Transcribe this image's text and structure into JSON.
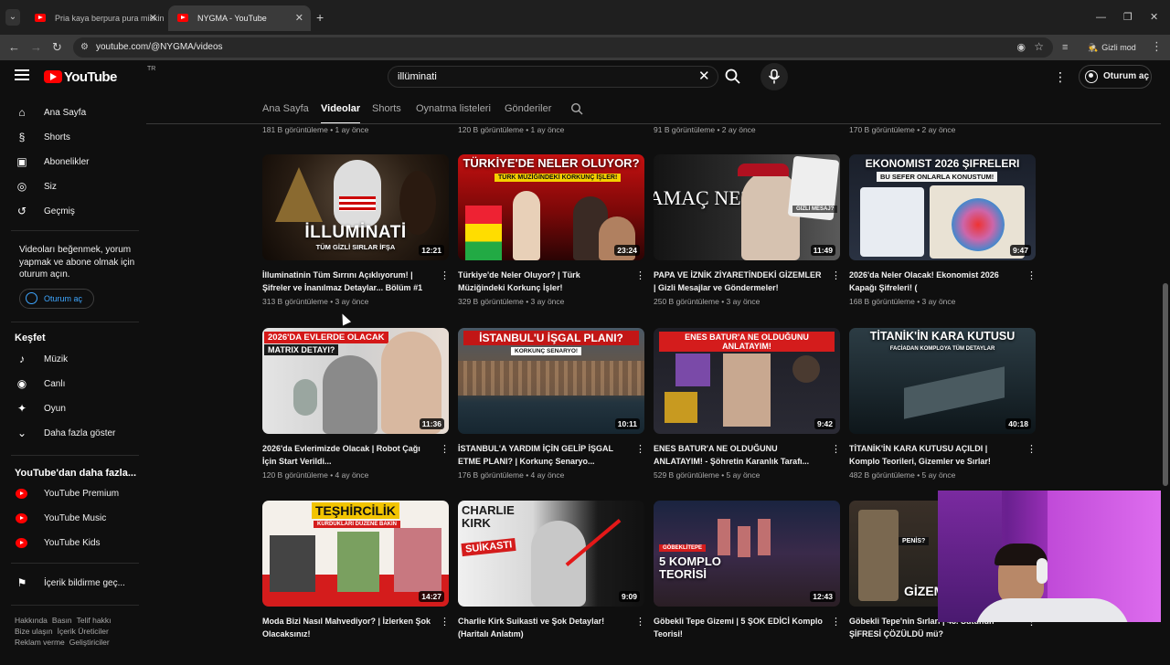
{
  "browser": {
    "tabs": [
      {
        "title": "Pria kaya berpura pura miskin u",
        "active": false
      },
      {
        "title": "NYGMA - YouTube",
        "active": true
      }
    ],
    "url": "youtube.com/@NYGMA/videos",
    "incognito_label": "Gizli mod"
  },
  "header": {
    "logo": "YouTube",
    "region": "TR",
    "search_query": "illüminati",
    "signin_label": "Oturum aç"
  },
  "sidebar": {
    "main": [
      {
        "label": "Ana Sayfa",
        "icon": "home-icon"
      },
      {
        "label": "Shorts",
        "icon": "shorts-icon"
      },
      {
        "label": "Abonelikler",
        "icon": "subscriptions-icon"
      },
      {
        "label": "Siz",
        "icon": "you-icon"
      },
      {
        "label": "Geçmiş",
        "icon": "history-icon"
      }
    ],
    "note": "Videoları beğenmek, yorum yapmak ve abone olmak için oturum açın.",
    "signin_label": "Oturum aç",
    "explore_heading": "Keşfet",
    "explore": [
      {
        "label": "Müzik",
        "icon": "music-icon"
      },
      {
        "label": "Canlı",
        "icon": "live-icon"
      },
      {
        "label": "Oyun",
        "icon": "gaming-icon"
      },
      {
        "label": "Daha fazla göster",
        "icon": "chevron-down-icon"
      }
    ],
    "more_heading": "YouTube'dan daha fazla...",
    "more": [
      {
        "label": "YouTube Premium"
      },
      {
        "label": "YouTube Music"
      },
      {
        "label": "YouTube Kids"
      }
    ],
    "report_label": "İçerik bildirme geç...",
    "footer_line1": [
      "Hakkında",
      "Basın",
      "Telif hakkı"
    ],
    "footer_line2": [
      "Bize ulaşın",
      "İçerik Üreticiler"
    ],
    "footer_line3": [
      "Reklam verme",
      "Geliştiriciler"
    ]
  },
  "channel_tabs": [
    "Ana Sayfa",
    "Videolar",
    "Shorts",
    "Oynatma listeleri",
    "Gönderiler"
  ],
  "active_tab": "Videolar",
  "previous_row_meta": [
    "181 B görüntüleme • 1 ay önce",
    "120 B görüntüleme • 1 ay önce",
    "91 B görüntüleme • 2 ay önce",
    "170 B görüntüleme • 2 ay önce"
  ],
  "videos": [
    {
      "title": "İlluminatinin Tüm Sırrını Açıklıyorum! | Şifreler ve İnanılmaz Detaylar... Bölüm #1",
      "meta": "313 B görüntüleme • 3 ay önce",
      "duration": "12:21",
      "thumb_text": "İLLUMİNATİ",
      "thumb_sub": "TÜM GİZLİ SIRLAR İFŞA"
    },
    {
      "title": "Türkiye'de Neler Oluyor? | Türk Müziğindeki Korkunç İşler!",
      "meta": "329 B görüntüleme • 3 ay önce",
      "duration": "23:24",
      "thumb_text": "TÜRKİYE'DE NELER OLUYOR?",
      "thumb_sub": "TÜRK MÜZİĞİNDEKİ KORKUNÇ İŞLER!"
    },
    {
      "title": "PAPA VE İZNİK ZİYARETİNDEKİ GİZEMLER | Gizli Mesajlar ve Göndermeler!",
      "meta": "250 B görüntüleme • 3 ay önce",
      "duration": "11:49",
      "thumb_text": "AMAÇ NE?",
      "thumb_sub": "GİZLİ MESAJ?"
    },
    {
      "title": "2026'da Neler Olacak! Ekonomist 2026 Kapağı Şifreleri! (",
      "meta": "168 B görüntüleme • 3 ay önce",
      "duration": "9:47",
      "thumb_text": "EKONOMIST 2026 ŞIFRELERI",
      "thumb_sub": "BU SEFER ONLARLA KONUSTUM!"
    },
    {
      "title": "2026'da Evlerimizde Olacak | Robot Çağı İçin Start Verildi...",
      "meta": "120 B görüntüleme • 4 ay önce",
      "duration": "11:36",
      "thumb_text": "2026'DA EVLERDE OLACAK",
      "thumb_sub": "MATRIX DETAYI?"
    },
    {
      "title": "İSTANBUL'A YARDIM İÇİN GELİP İŞGAL ETME PLANI? | Korkunç Senaryo...",
      "meta": "176 B görüntüleme • 4 ay önce",
      "duration": "10:11",
      "thumb_text": "İSTANBUL'U İŞGAL PLANI?",
      "thumb_sub": "KORKUNÇ SENARYO!"
    },
    {
      "title": "ENES BATUR'A NE OLDUĞUNU ANLATAYIM! - Şöhretin Karanlık Tarafı...",
      "meta": "529 B görüntüleme • 5 ay önce",
      "duration": "9:42",
      "thumb_text": "ENES BATUR'A NE OLDUĞUNU ANLATAYIM!",
      "thumb_sub": ""
    },
    {
      "title": "TİTANİK'İN KARA KUTUSU AÇILDI | Komplo Teorileri, Gizemler ve Sırlar!",
      "meta": "482 B görüntüleme • 5 ay önce",
      "duration": "40:18",
      "thumb_text": "TİTANİK'İN KARA KUTUSU",
      "thumb_sub": "FACİADAN KOMPLOYA TÜM DETAYLAR"
    },
    {
      "title": "Moda Bizi Nasıl Mahvediyor? | İzlerken Şok Olacaksınız!",
      "meta": "",
      "duration": "14:27",
      "thumb_text": "TEŞHİRCİLİK",
      "thumb_sub": "KURDUKLARI DÜZENE BAKIN"
    },
    {
      "title": "Charlie Kirk Suikasti ve Şok Detaylar! (Haritalı Anlatım)",
      "meta": "",
      "duration": "9:09",
      "thumb_text": "CHARLIE KIRK",
      "thumb_sub": "SUİKASTI"
    },
    {
      "title": "Göbekli Tepe Gizemi | 5 ŞOK EDİCİ Komplo Teorisi!",
      "meta": "",
      "duration": "12:43",
      "thumb_text": "5 KOMPLO TEORİSİ",
      "thumb_sub": "GÖBEKLİTEPE"
    },
    {
      "title": "Göbekli Tepe'nin Sırları | 43. Sütunun ŞİFRESİ ÇÖZÜLDÜ mü?",
      "meta": "",
      "duration": "",
      "thumb_text": "GİZEMLE",
      "thumb_sub": "PENİS?"
    }
  ]
}
